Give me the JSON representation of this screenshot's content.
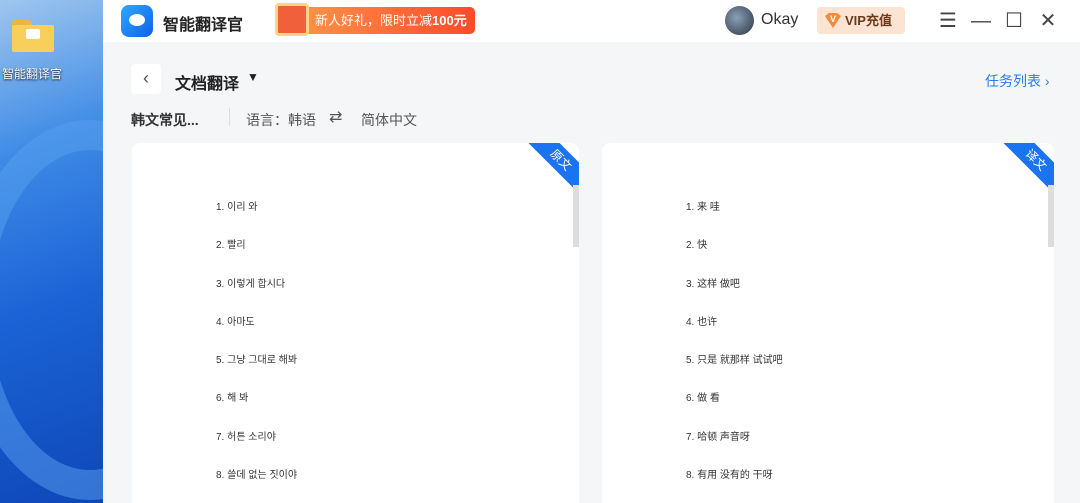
{
  "desktop": {
    "icon_label": "智能翻译官"
  },
  "titlebar": {
    "app_name": "智能翻译官",
    "promo": "新人好礼，限时立减",
    "promo_amount": "100元",
    "user": "Okay",
    "vip": "VIP充值",
    "vip_badge": "V",
    "menu": "☰",
    "minimize": "—",
    "maximize": "☐",
    "close": "✕"
  },
  "header": {
    "back": "‹",
    "title": "文档翻译",
    "caret": "▼",
    "task_list": "任务列表 ›",
    "filename": "韩文常见...",
    "language": "语言：韩语",
    "swap": "⇄",
    "target": "简体中文"
  },
  "source": {
    "badge": "原文",
    "lines": [
      "1. 이리 와",
      "2.  빨리",
      "3. 이렇게 합시다",
      "4.  아마도",
      "5. 그냥 그대로 해봐",
      "6.  해 봐",
      "7. 허튼 소리야",
      "8.  쓸데 없는 짓이야"
    ]
  },
  "translation": {
    "badge": "译文",
    "lines": [
      "1. 来 哇",
      "2.  快",
      "3. 这样 做吧",
      "4.  也许",
      "5. 只是 就那样 试试吧",
      "6.  做 看",
      "7. 哈顿 声音呀",
      "8.  有用 没有的 干呀"
    ]
  }
}
